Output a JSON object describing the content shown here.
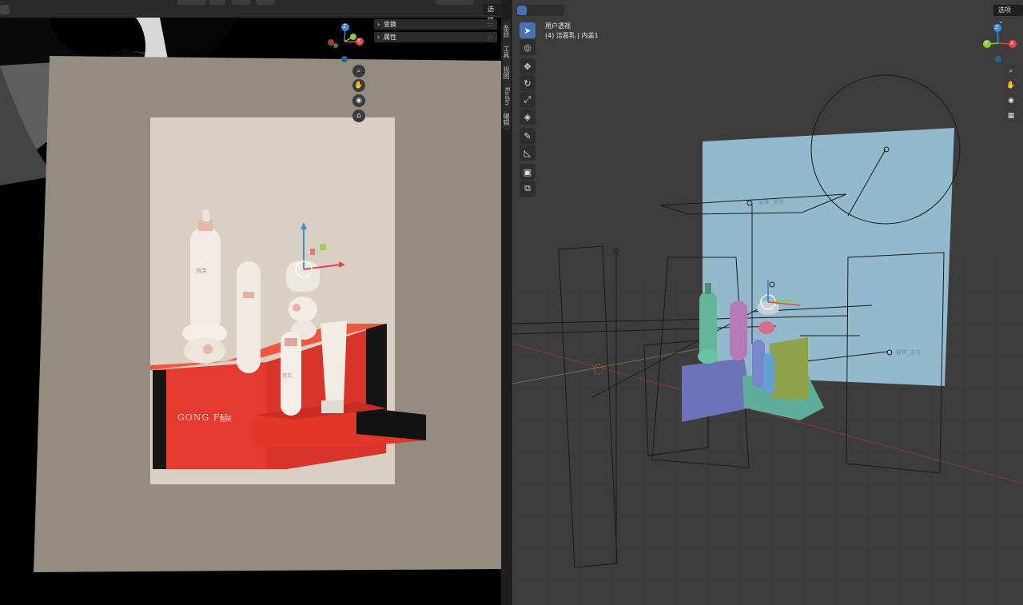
{
  "left_view": {
    "options_label": "选项 ⌄",
    "panels": [
      {
        "label": "变换"
      },
      {
        "label": "属性"
      }
    ],
    "side_tabs": [
      "条目",
      "工具",
      "视图",
      "Rodin",
      "编辑"
    ],
    "gizmo": {
      "x": "X",
      "y": "Y",
      "z": "Z"
    },
    "render": {
      "brand_text": "GONG FU",
      "brand_cn": "宫芙",
      "bottle_label": "宫芙"
    }
  },
  "right_view": {
    "options_label": "选项 ⌄",
    "viewport_title": "用户透视",
    "viewport_subtitle": "(4) 洁面乳 | 内盖1",
    "gizmo": {
      "x": "X",
      "y": "Y",
      "z": "Z"
    },
    "scene_labels": {
      "area_light": "窗体_顶光",
      "area_light2": "窗体_主光"
    },
    "tools": [
      "select-box",
      "cursor",
      "move",
      "rotate",
      "scale",
      "transform",
      "annotate",
      "measure",
      "add-cube",
      "add-object"
    ]
  },
  "colors": {
    "accent": "#4772b3",
    "axis_x": "#e6454e",
    "axis_y": "#8ccb32",
    "axis_z": "#3b8de0",
    "panel_bg": "#2b2b2b",
    "viewport_bg": "#3c3c3c",
    "box_red": "#e53a2f",
    "backdrop_blue": "#93b9cc"
  }
}
